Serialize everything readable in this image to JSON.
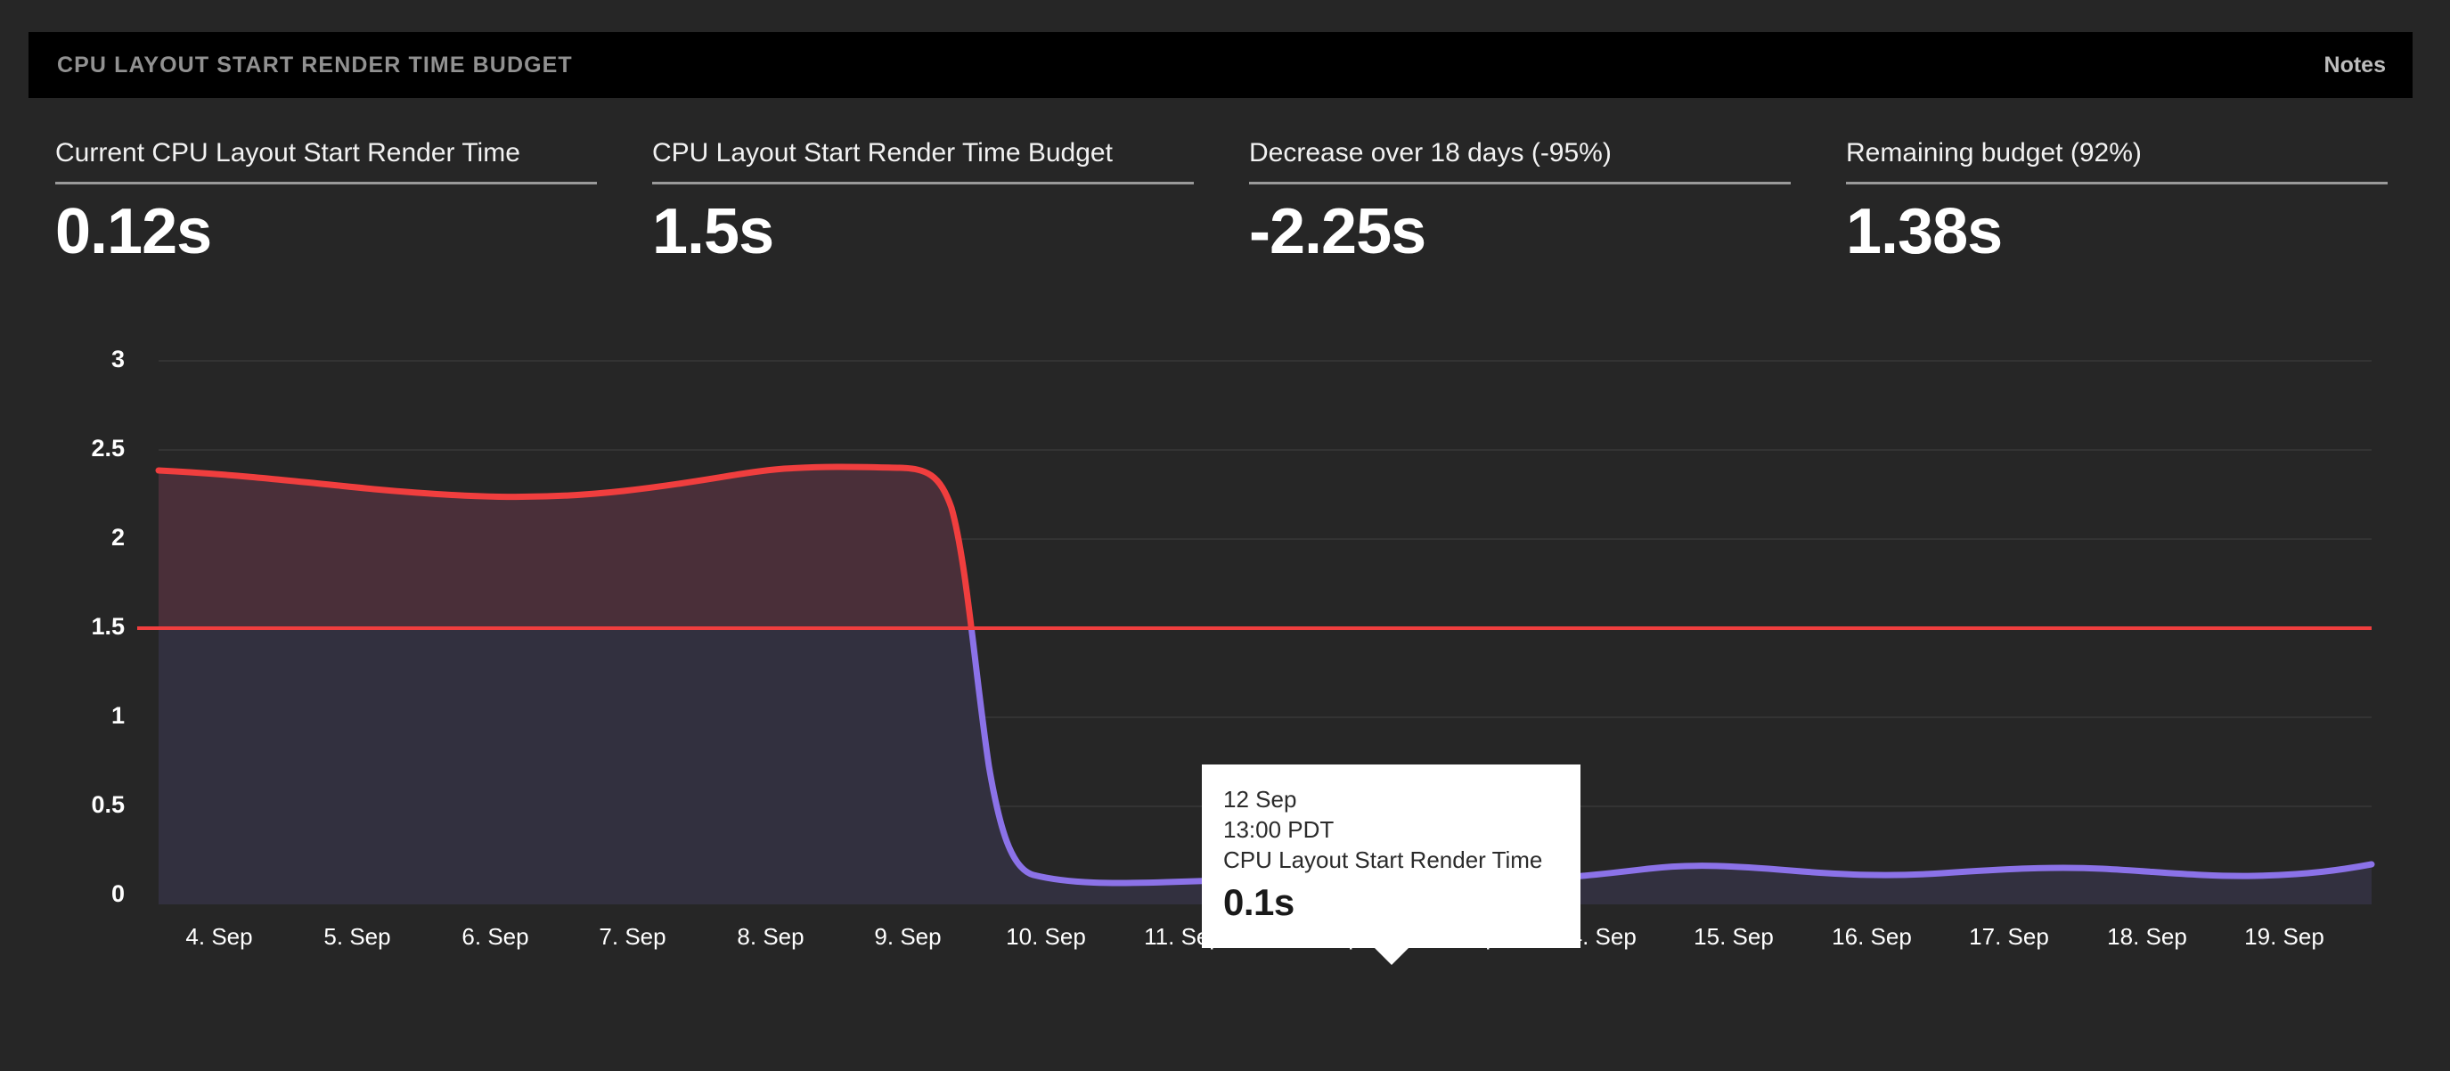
{
  "header": {
    "title": "CPU Layout Start Render Time Budget",
    "notes_label": "Notes"
  },
  "kpis": [
    {
      "label": "Current CPU Layout Start Render Time",
      "value": "0.12s"
    },
    {
      "label": "CPU Layout Start Render Time Budget",
      "value": "1.5s"
    },
    {
      "label": "Decrease over 18 days (-95%)",
      "value": "-2.25s"
    },
    {
      "label": "Remaining budget (92%)",
      "value": "1.38s"
    }
  ],
  "tooltip": {
    "date": "12 Sep",
    "time": "13:00 PDT",
    "metric": "CPU Layout Start Render Time",
    "value": "0.1s"
  },
  "colors": {
    "page_background": "#262626",
    "header_background": "#000000",
    "header_title": "#919191",
    "over_budget_line": "#f03e3e",
    "over_budget_fill": "#4a2f39",
    "under_budget_line": "#8b72e8",
    "under_budget_fill": "#32303f",
    "budget_threshold_line": "#f03e3e",
    "gridline": "#333333",
    "marker_fill": "#8b72e8",
    "marker_ring": "#ffffff",
    "tooltip_background": "#ffffff"
  },
  "chart_data": {
    "type": "area",
    "title": "CPU Layout Start Render Time Budget",
    "xlabel": "",
    "ylabel": "",
    "ylim": [
      0,
      3
    ],
    "yticks": [
      0,
      0.5,
      1,
      1.5,
      2,
      2.5,
      3
    ],
    "ytick_labels": [
      "0",
      "0.5",
      "1",
      "1.5",
      "2",
      "2.5",
      "3"
    ],
    "grid": true,
    "legend": "none",
    "categories": [
      "4. Sep",
      "5. Sep",
      "6. Sep",
      "7. Sep",
      "8. Sep",
      "9. Sep",
      "10. Sep",
      "11. Sep",
      "12. Sep",
      "13. Sep",
      "14. Sep",
      "15. Sep",
      "16. Sep",
      "17. Sep",
      "18. Sep",
      "19. Sep"
    ],
    "threshold": {
      "label": "CPU Layout Start Render Time Budget",
      "value": 1.5
    },
    "series": [
      {
        "name": "CPU Layout Start Render Time",
        "values": [
          2.38,
          2.33,
          2.28,
          2.3,
          2.4,
          2.4,
          2.4,
          2.39,
          0.11,
          0.09,
          0.1,
          0.11,
          0.1,
          0.12,
          0.09,
          0.1,
          0.1,
          0.08,
          0.09,
          0.11,
          0.12,
          0.11,
          0.1,
          0.1,
          0.11,
          0.12
        ]
      }
    ],
    "highlight_point": {
      "x": "12 Sep",
      "time": "13:00 PDT",
      "y": 0.1,
      "label": "0.1s"
    },
    "annotations": [
      {
        "type": "tooltip",
        "text": "12 Sep / 13:00 PDT / CPU Layout Start Render Time / 0.1s"
      }
    ]
  }
}
